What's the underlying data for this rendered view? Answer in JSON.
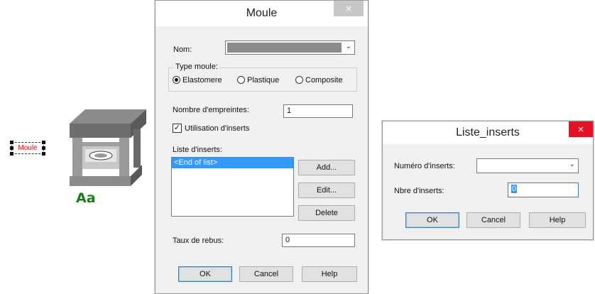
{
  "canvas": {
    "moule_label": "Moule",
    "aa_label": "Aa"
  },
  "moule_dialog": {
    "title": "Moule",
    "close": "×",
    "nom_label": "Nom:",
    "type_moule_label": "Type moule:",
    "type_options": [
      "Elastomere",
      "Plastique",
      "Composite"
    ],
    "type_selected": "Elastomere",
    "nombre_label": "Nombre d'empreintes:",
    "nombre_value": "1",
    "utilisation_label": "Utilisation d'inserts",
    "utilisation_checked": true,
    "check_mark": "✓",
    "liste_label": "Liste d'inserts:",
    "list_items": [
      "<End of list>"
    ],
    "add_label": "Add...",
    "edit_label": "Edit...",
    "delete_label": "Delete",
    "taux_label": "Taux de rebus:",
    "taux_value": "0",
    "ok_label": "OK",
    "cancel_label": "Cancel",
    "help_label": "Help"
  },
  "inserts_dialog": {
    "title": "Liste_inserts",
    "close": "×",
    "numero_label": "Numéro d'inserts:",
    "numero_value": "",
    "nbre_label": "Nbre d'inserts:",
    "nbre_value": "0",
    "ok_label": "OK",
    "cancel_label": "Cancel",
    "help_label": "Help"
  },
  "colors": {
    "close_inactive": "#c7c7c7",
    "close_active": "#e81123",
    "selection": "#3399ff",
    "aa_green": "#1a7a1a",
    "label_red": "#dd1111"
  }
}
